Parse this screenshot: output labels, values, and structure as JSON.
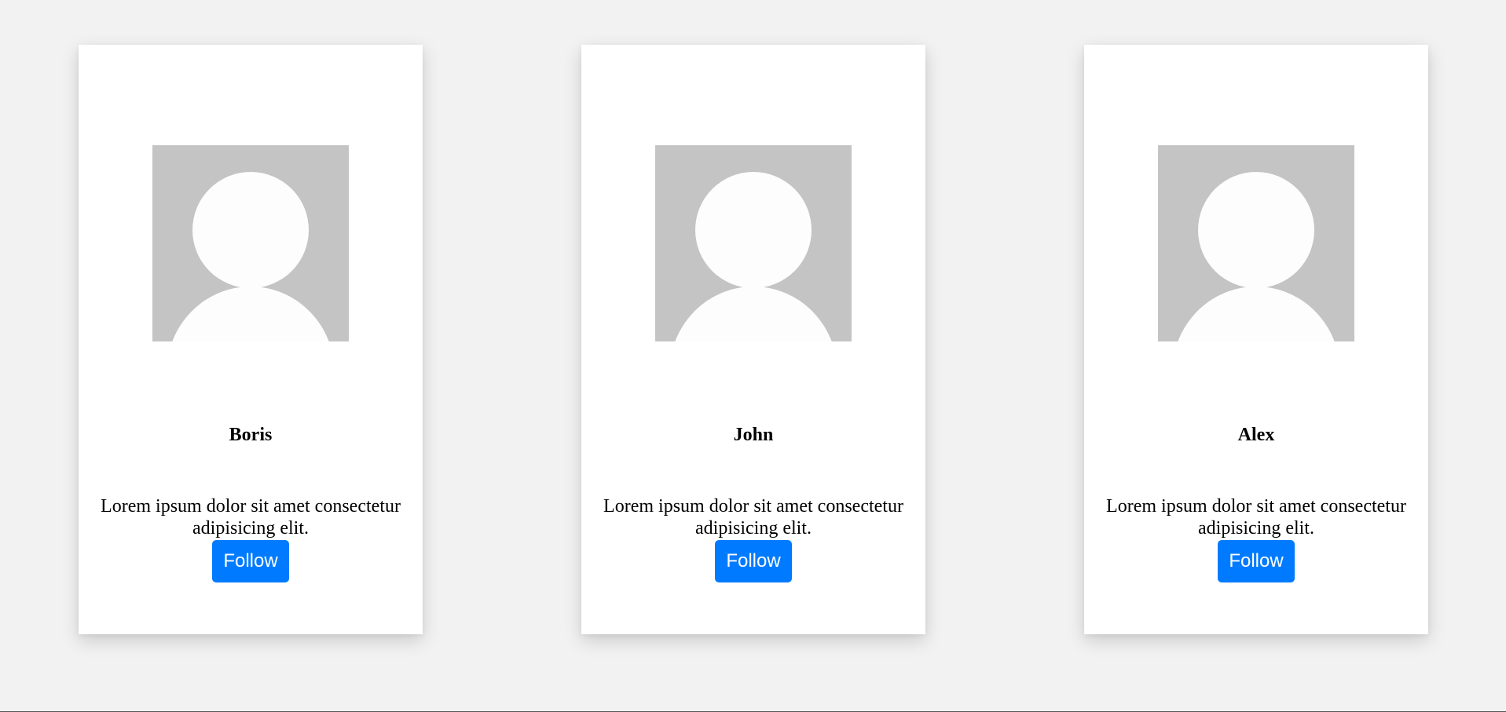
{
  "cards": [
    {
      "name": "Boris",
      "description": "Lorem ipsum dolor sit amet consectetur adipisicing elit.",
      "button_label": "Follow",
      "avatar_icon": "user-avatar-placeholder"
    },
    {
      "name": "John",
      "description": "Lorem ipsum dolor sit amet consectetur adipisicing elit.",
      "button_label": "Follow",
      "avatar_icon": "user-avatar-placeholder"
    },
    {
      "name": "Alex",
      "description": "Lorem ipsum dolor sit amet consectetur adipisicing elit.",
      "button_label": "Follow",
      "avatar_icon": "user-avatar-placeholder"
    }
  ],
  "colors": {
    "page_background": "#f2f2f2",
    "card_background": "#ffffff",
    "avatar_background": "#c4c4c4",
    "avatar_figure": "#fdfdfd",
    "button_background": "#007bff",
    "button_text": "#ffffff"
  }
}
